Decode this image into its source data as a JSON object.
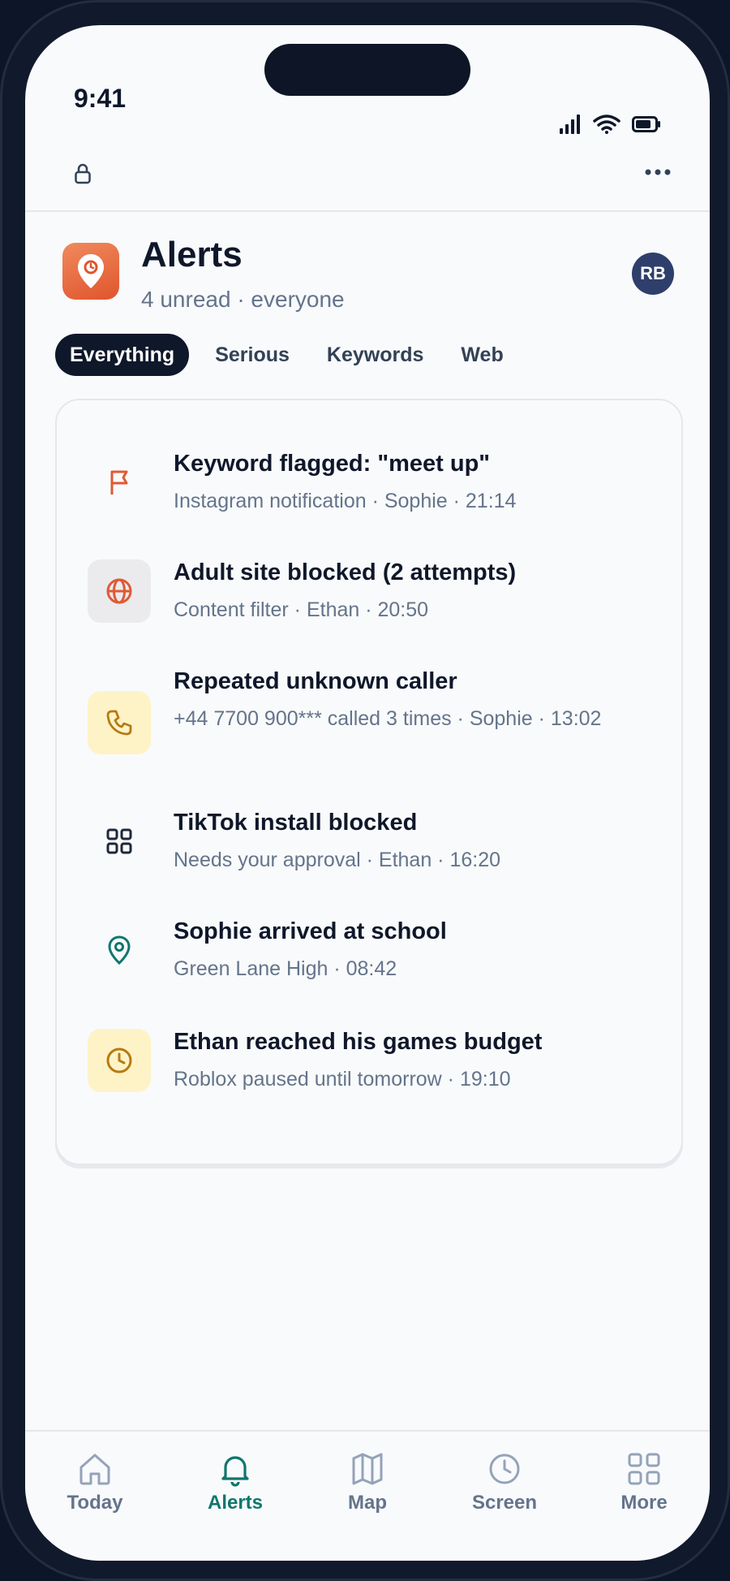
{
  "status_bar": {
    "time": "9:41"
  },
  "header": {
    "title": "Alerts",
    "subtitle": "4 unread · everyone",
    "avatar_initials": "RB",
    "app_icon": "location-pin-icon"
  },
  "filters": {
    "tabs": [
      "Everything",
      "Serious",
      "Keywords",
      "Web"
    ],
    "active": "Everything"
  },
  "alerts": [
    {
      "title": "Keyword flagged: \"meet up\"",
      "meta": "Instagram notification · Sophie · 21:14",
      "icon": "flag-icon",
      "color": "#e05a34"
    },
    {
      "title": "Adult site blocked (2 attempts)",
      "meta": "Content filter · Ethan · 20:50",
      "icon": "globe-icon",
      "color": "#e05a34"
    },
    {
      "title": "Repeated unknown caller",
      "meta": "+44 7700 900*** called 3 times · Sophie · 13:02",
      "icon": "phone-icon",
      "color": "#b77a12"
    },
    {
      "title": "TikTok install blocked",
      "meta": "Needs your approval · Ethan · 16:20",
      "icon": "apps-grid-icon",
      "color": "#1e293b"
    },
    {
      "title": "Sophie arrived at school",
      "meta": "Green Lane High · 08:42",
      "icon": "map-pin-icon",
      "color": "#0f766e"
    },
    {
      "title": "Ethan reached his games budget",
      "meta": "Roblox paused until tomorrow · 19:10",
      "icon": "clock-icon",
      "color": "#b77a12"
    }
  ],
  "nav": [
    {
      "label": "Today",
      "icon": "home-icon"
    },
    {
      "label": "Alerts",
      "icon": "bell-icon"
    },
    {
      "label": "Map",
      "icon": "map-icon"
    },
    {
      "label": "Screen",
      "icon": "clock-icon"
    },
    {
      "label": "More",
      "icon": "grid-icon"
    }
  ],
  "colors": {
    "accent": "#0f766e",
    "danger": "#e05a34",
    "warning": "#b77a12",
    "dark": "#0f172a",
    "muted": "#64748b"
  }
}
